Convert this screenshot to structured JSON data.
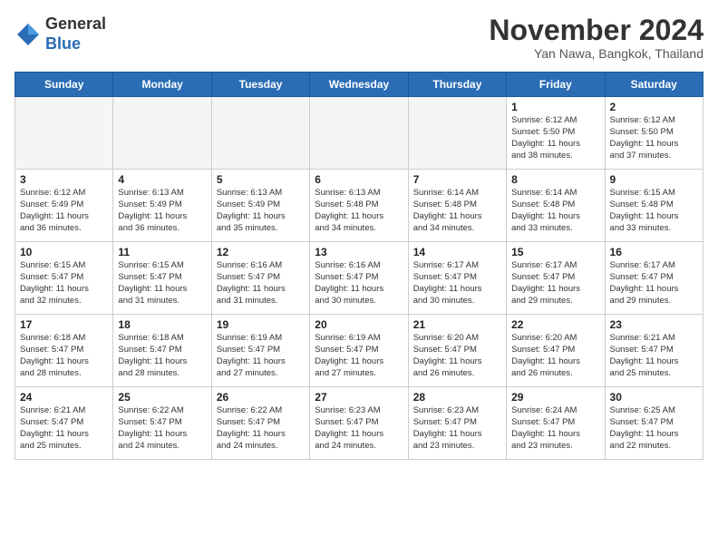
{
  "header": {
    "logo_general": "General",
    "logo_blue": "Blue",
    "month_title": "November 2024",
    "location": "Yan Nawa, Bangkok, Thailand"
  },
  "weekdays": [
    "Sunday",
    "Monday",
    "Tuesday",
    "Wednesday",
    "Thursday",
    "Friday",
    "Saturday"
  ],
  "weeks": [
    [
      {
        "day": "",
        "info": ""
      },
      {
        "day": "",
        "info": ""
      },
      {
        "day": "",
        "info": ""
      },
      {
        "day": "",
        "info": ""
      },
      {
        "day": "",
        "info": ""
      },
      {
        "day": "1",
        "info": "Sunrise: 6:12 AM\nSunset: 5:50 PM\nDaylight: 11 hours\nand 38 minutes."
      },
      {
        "day": "2",
        "info": "Sunrise: 6:12 AM\nSunset: 5:50 PM\nDaylight: 11 hours\nand 37 minutes."
      }
    ],
    [
      {
        "day": "3",
        "info": "Sunrise: 6:12 AM\nSunset: 5:49 PM\nDaylight: 11 hours\nand 36 minutes."
      },
      {
        "day": "4",
        "info": "Sunrise: 6:13 AM\nSunset: 5:49 PM\nDaylight: 11 hours\nand 36 minutes."
      },
      {
        "day": "5",
        "info": "Sunrise: 6:13 AM\nSunset: 5:49 PM\nDaylight: 11 hours\nand 35 minutes."
      },
      {
        "day": "6",
        "info": "Sunrise: 6:13 AM\nSunset: 5:48 PM\nDaylight: 11 hours\nand 34 minutes."
      },
      {
        "day": "7",
        "info": "Sunrise: 6:14 AM\nSunset: 5:48 PM\nDaylight: 11 hours\nand 34 minutes."
      },
      {
        "day": "8",
        "info": "Sunrise: 6:14 AM\nSunset: 5:48 PM\nDaylight: 11 hours\nand 33 minutes."
      },
      {
        "day": "9",
        "info": "Sunrise: 6:15 AM\nSunset: 5:48 PM\nDaylight: 11 hours\nand 33 minutes."
      }
    ],
    [
      {
        "day": "10",
        "info": "Sunrise: 6:15 AM\nSunset: 5:47 PM\nDaylight: 11 hours\nand 32 minutes."
      },
      {
        "day": "11",
        "info": "Sunrise: 6:15 AM\nSunset: 5:47 PM\nDaylight: 11 hours\nand 31 minutes."
      },
      {
        "day": "12",
        "info": "Sunrise: 6:16 AM\nSunset: 5:47 PM\nDaylight: 11 hours\nand 31 minutes."
      },
      {
        "day": "13",
        "info": "Sunrise: 6:16 AM\nSunset: 5:47 PM\nDaylight: 11 hours\nand 30 minutes."
      },
      {
        "day": "14",
        "info": "Sunrise: 6:17 AM\nSunset: 5:47 PM\nDaylight: 11 hours\nand 30 minutes."
      },
      {
        "day": "15",
        "info": "Sunrise: 6:17 AM\nSunset: 5:47 PM\nDaylight: 11 hours\nand 29 minutes."
      },
      {
        "day": "16",
        "info": "Sunrise: 6:17 AM\nSunset: 5:47 PM\nDaylight: 11 hours\nand 29 minutes."
      }
    ],
    [
      {
        "day": "17",
        "info": "Sunrise: 6:18 AM\nSunset: 5:47 PM\nDaylight: 11 hours\nand 28 minutes."
      },
      {
        "day": "18",
        "info": "Sunrise: 6:18 AM\nSunset: 5:47 PM\nDaylight: 11 hours\nand 28 minutes."
      },
      {
        "day": "19",
        "info": "Sunrise: 6:19 AM\nSunset: 5:47 PM\nDaylight: 11 hours\nand 27 minutes."
      },
      {
        "day": "20",
        "info": "Sunrise: 6:19 AM\nSunset: 5:47 PM\nDaylight: 11 hours\nand 27 minutes."
      },
      {
        "day": "21",
        "info": "Sunrise: 6:20 AM\nSunset: 5:47 PM\nDaylight: 11 hours\nand 26 minutes."
      },
      {
        "day": "22",
        "info": "Sunrise: 6:20 AM\nSunset: 5:47 PM\nDaylight: 11 hours\nand 26 minutes."
      },
      {
        "day": "23",
        "info": "Sunrise: 6:21 AM\nSunset: 5:47 PM\nDaylight: 11 hours\nand 25 minutes."
      }
    ],
    [
      {
        "day": "24",
        "info": "Sunrise: 6:21 AM\nSunset: 5:47 PM\nDaylight: 11 hours\nand 25 minutes."
      },
      {
        "day": "25",
        "info": "Sunrise: 6:22 AM\nSunset: 5:47 PM\nDaylight: 11 hours\nand 24 minutes."
      },
      {
        "day": "26",
        "info": "Sunrise: 6:22 AM\nSunset: 5:47 PM\nDaylight: 11 hours\nand 24 minutes."
      },
      {
        "day": "27",
        "info": "Sunrise: 6:23 AM\nSunset: 5:47 PM\nDaylight: 11 hours\nand 24 minutes."
      },
      {
        "day": "28",
        "info": "Sunrise: 6:23 AM\nSunset: 5:47 PM\nDaylight: 11 hours\nand 23 minutes."
      },
      {
        "day": "29",
        "info": "Sunrise: 6:24 AM\nSunset: 5:47 PM\nDaylight: 11 hours\nand 23 minutes."
      },
      {
        "day": "30",
        "info": "Sunrise: 6:25 AM\nSunset: 5:47 PM\nDaylight: 11 hours\nand 22 minutes."
      }
    ]
  ]
}
